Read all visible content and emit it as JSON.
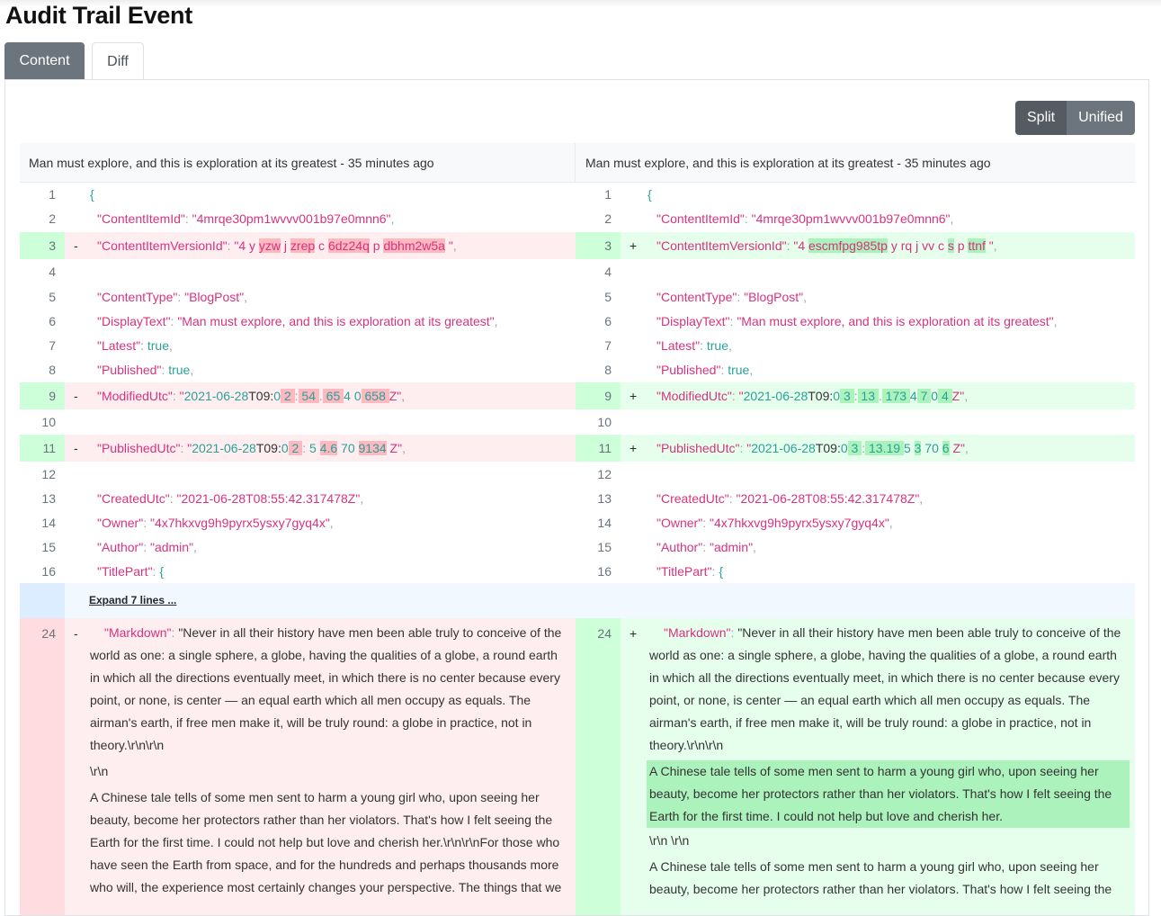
{
  "page": {
    "title": "Audit Trail Event"
  },
  "tabs": {
    "content": "Content",
    "diff": "Diff"
  },
  "view_toggle": {
    "split": "Split",
    "unified": "Unified"
  },
  "headers": {
    "left": "Man must explore, and this is exploration at its greatest - 35 minutes ago",
    "right": "Man must explore, and this is exploration at its greatest - 35 minutes ago"
  },
  "lines": {
    "n1": "1",
    "n2": "2",
    "n3": "3",
    "n4": "4",
    "n5": "5",
    "n6": "6",
    "n7": "7",
    "n8": "8",
    "n9": "9",
    "n10": "10",
    "n11": "11",
    "n12": "12",
    "n13": "13",
    "n14": "14",
    "n15": "15",
    "n16": "16",
    "n24": "24"
  },
  "marks": {
    "del": "-",
    "add": "+"
  },
  "json": {
    "brace": "{",
    "content_item_id_key": "\"ContentItemId\"",
    "content_item_id_val": "\"4mrqe30pm1wvvv001b97e0mnn6\"",
    "version_key": "\"ContentItemVersionId\"",
    "version_old": [
      "\"4 ",
      "y ",
      "yzw",
      " j ",
      "zrep",
      " c ",
      "6",
      "dz24q",
      " p ",
      "dbhm2w5a",
      " \""
    ],
    "version_new": [
      "\"4 ",
      "escmfpg985tp",
      " y rq j vv c ",
      "s",
      " p ",
      "ttnf",
      " \""
    ],
    "content_type_key": "\"ContentType\"",
    "content_type_val": "\"BlogPost\"",
    "display_text_key": "\"DisplayText\"",
    "display_text_val": "\"Man must explore, and this is exploration at its greatest\"",
    "latest_key": "\"Latest\"",
    "published_key": "\"Published\"",
    "true": "true",
    "modified_key": "\"ModifiedUtc\"",
    "modified_old": [
      "\"",
      "2021-06-28",
      "T09:",
      "0",
      " 2 ",
      ":",
      " 54 ",
      ".",
      " 65 ",
      "4 0",
      " 658 ",
      "Z\""
    ],
    "modified_new": [
      "\"",
      "2021-06-28",
      "T09:",
      "0",
      " 3 ",
      ":",
      " 13 ",
      ".",
      " 173 ",
      "4",
      " 7 ",
      "0",
      " 4 ",
      "Z\""
    ],
    "published_utc_key": "\"PublishedUtc\"",
    "published_old": [
      "\"",
      "2021-06-28",
      "T09:",
      "0",
      " 2 ",
      ":",
      " 5 ",
      "4.6",
      " 70 ",
      "9134",
      " Z\""
    ],
    "published_new": [
      "\"",
      "2021-06-28",
      "T09:",
      "0",
      " 3 ",
      ":",
      " 13.19 ",
      "5 ",
      "3",
      " 70 ",
      "6",
      " Z\""
    ],
    "created_key": "\"CreatedUtc\"",
    "created_val": "\"2021-06-28T08:55:42.317478Z\"",
    "owner_key": "\"Owner\"",
    "owner_val": "\"4x7hkxvg9h9pyrx5ysxy7gyq4x\"",
    "author_key": "\"Author\"",
    "author_val": "\"admin\"",
    "title_part_key": "\"TitlePart\""
  },
  "expand": {
    "label": "Expand 7 lines ..."
  },
  "markdown": {
    "key": "\"Markdown\"",
    "intro": "\"Never in all their history have men been able truly to conceive of the world as one: a single sphere, a globe, having the qualities of a globe, a round earth in which all the directions eventually meet, in which there is no center because every point, or none, is center — an equal earth which all men occupy as equals. The airman's earth, if free men make it, will be truly round: a globe in practice, not in theory.\\r\\n\\r\\n",
    "crlf": "\\r\\n",
    "crlf2": "\\r\\n \\r\\n",
    "chinese_tale_left": "A Chinese tale tells of some men sent to harm a young girl who, upon seeing her beauty, become her protectors rather than her violators. That's how I felt seeing the Earth for the first time. I could not help but love and cherish her.\\r\\n\\r\\nFor those who have seen the Earth from space, and for the hundreds and perhaps thousands more who will, the experience most certainly changes your perspective. The things that we",
    "chinese_tale_right": "A Chinese tale tells of some men sent to harm a young girl who, upon seeing her beauty, become her protectors rather than her violators. That's how I felt seeing the Earth for the first time. I could not help but love and cherish her.",
    "chinese_tale_right2": "A Chinese tale tells of some men sent to harm a young girl who, upon seeing her beauty, become her protectors rather than her violators. That's how I felt seeing the"
  }
}
